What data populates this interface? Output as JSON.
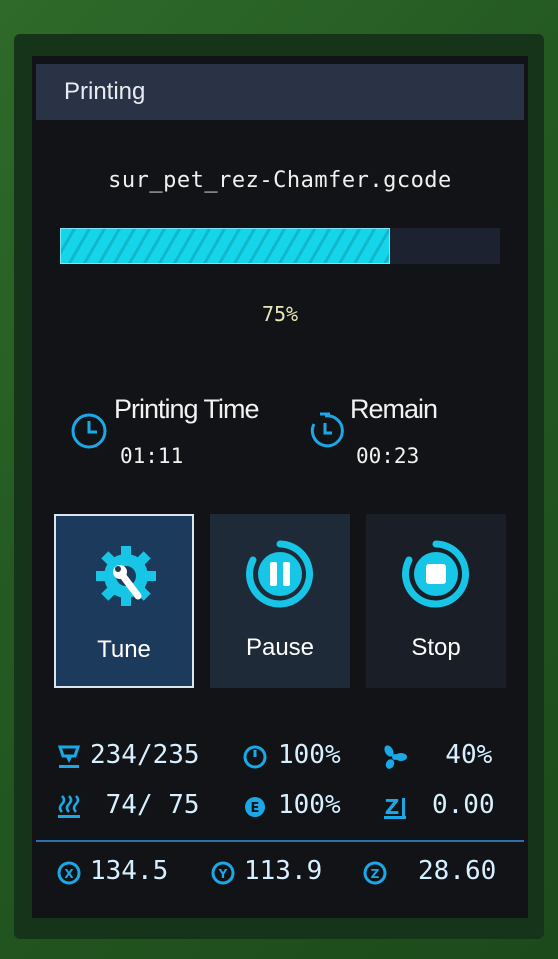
{
  "header": {
    "title": "Printing"
  },
  "job": {
    "filename": "sur_pet_rez-Chamfer.gcode",
    "progress_text": "75%",
    "progress": 0.75
  },
  "times": {
    "printing_label": "Printing Time",
    "printing_value": "01:11",
    "remain_label": "Remain",
    "remain_value": "00:23"
  },
  "buttons": {
    "tune": "Tune",
    "pause": "Pause",
    "stop": "Stop"
  },
  "status": {
    "nozzle": "234/235",
    "speed": "100%",
    "fan": "  40%",
    "bed": " 74/ 75",
    "flow": "100%",
    "z_offset": "0.00",
    "x": "134.5",
    "y": "113.9",
    "z": "28.60"
  },
  "colors": {
    "accent": "#14d5ea",
    "title_bar": "#2a3346",
    "selected_button": "#1b3a5c"
  }
}
